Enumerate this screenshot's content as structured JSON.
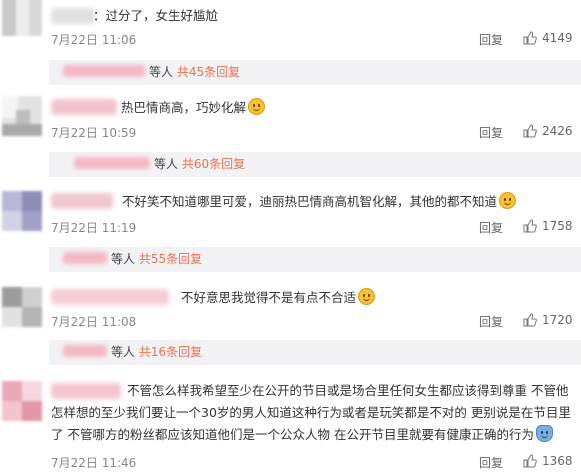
{
  "comments": [
    {
      "text": "：过分了，女生好尴尬",
      "emoji": "",
      "time": "7月22日 11:06",
      "reply": "回复",
      "likes": "4149",
      "sub": {
        "people": "等人",
        "count": "共45条回复"
      }
    },
    {
      "text": "热巴情商高，巧妙化解",
      "emoji": "smile-emoji",
      "time": "7月22日 10:59",
      "reply": "回复",
      "likes": "2426",
      "sub": {
        "people": "等人",
        "count": "共60条回复"
      }
    },
    {
      "text": "不好笑不知道哪里可爱，迪丽热巴情商高机智化解，其他的都不知道",
      "emoji": "smile-emoji",
      "time": "7月22日 11:19",
      "reply": "回复",
      "likes": "1758",
      "sub": {
        "people": "等人",
        "count": "共55条回复"
      }
    },
    {
      "text": "不好意思我觉得不是有点不合适",
      "emoji": "smile-emoji",
      "time": "7月22日 11:08",
      "reply": "回复",
      "likes": "1720",
      "sub": {
        "people": "等人",
        "count": "共16条回复"
      }
    },
    {
      "text": "不管怎么样我希望至少在公开的节目或是场合里任何女生都应该得到尊重 不管他怎样想的至少我们要让一个30岁的男人知道这种行为或者是玩笑都是不对的 更别说是在节目里了 不管哪方的粉丝都应该知道他们是一个公众人物 在公开节目里就要有健康正确的行为",
      "emoji": "bag-emoji",
      "time": "7月22日 11:46",
      "reply": "回复",
      "likes": "1368"
    }
  ],
  "colors": {
    "reply_count": "#eb7350",
    "sub_background": "#f2f2f5",
    "emoji": "#f6c22f"
  },
  "icons": [
    "thumbs-up-icon",
    "smile-emoji",
    "bag-emoji"
  ]
}
